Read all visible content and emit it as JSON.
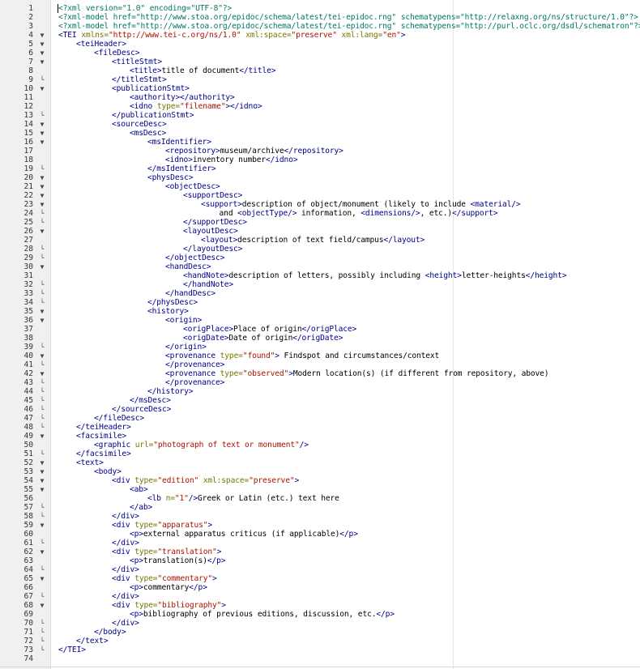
{
  "editor": {
    "colors": {
      "tag": "#000088",
      "attribute": "#777700",
      "value": "#aa1100",
      "processing_instruction": "#007766",
      "text": "#000000",
      "gutter": "#f0f0f0"
    },
    "lines": [
      {
        "n": "1",
        "fold": "",
        "indent": 0,
        "code": [
          [
            "pi",
            "<?xml version=\"1.0\" encoding=\"UTF-8\"?>"
          ]
        ]
      },
      {
        "n": "2",
        "fold": "",
        "indent": 0,
        "code": [
          [
            "pi",
            "<?xml-model href=\"http://www.stoa.org/epidoc/schema/latest/tei-epidoc.rng\" schematypens=\"http://relaxng.org/ns/structure/1.0\"?>"
          ]
        ]
      },
      {
        "n": "3",
        "fold": "",
        "indent": 0,
        "code": [
          [
            "pi",
            "<?xml-model href=\"http://www.stoa.org/epidoc/schema/latest/tei-epidoc.rng\" schematypens=\"http://purl.oclc.org/dsdl/schematron\"?>"
          ]
        ]
      },
      {
        "n": "4",
        "fold": "open",
        "indent": 0,
        "code": [
          [
            "t",
            "<TEI"
          ],
          [
            "x",
            " "
          ],
          [
            "a",
            "xmlns="
          ],
          [
            "v",
            "\"http://www.tei-c.org/ns/1.0\""
          ],
          [
            "x",
            " "
          ],
          [
            "a",
            "xml:space="
          ],
          [
            "v",
            "\"preserve\""
          ],
          [
            "x",
            " "
          ],
          [
            "a",
            "xml:lang="
          ],
          [
            "v",
            "\"en\""
          ],
          [
            "t",
            ">"
          ]
        ]
      },
      {
        "n": "5",
        "fold": "open",
        "indent": 1,
        "code": [
          [
            "t",
            "<teiHeader>"
          ]
        ]
      },
      {
        "n": "6",
        "fold": "open",
        "indent": 2,
        "code": [
          [
            "t",
            "<fileDesc>"
          ]
        ]
      },
      {
        "n": "7",
        "fold": "open",
        "indent": 3,
        "code": [
          [
            "t",
            "<titleStmt>"
          ]
        ]
      },
      {
        "n": "8",
        "fold": "",
        "indent": 4,
        "code": [
          [
            "t",
            "<title>"
          ],
          [
            "x",
            "title of document"
          ],
          [
            "t",
            "</title>"
          ]
        ]
      },
      {
        "n": "9",
        "fold": "close",
        "indent": 3,
        "code": [
          [
            "t",
            "</titleStmt>"
          ]
        ]
      },
      {
        "n": "10",
        "fold": "open",
        "indent": 3,
        "code": [
          [
            "t",
            "<publicationStmt>"
          ]
        ]
      },
      {
        "n": "11",
        "fold": "",
        "indent": 4,
        "code": [
          [
            "t",
            "<authority></authority>"
          ]
        ]
      },
      {
        "n": "12",
        "fold": "",
        "indent": 4,
        "code": [
          [
            "t",
            "<idno"
          ],
          [
            "x",
            " "
          ],
          [
            "a",
            "type="
          ],
          [
            "v",
            "\"filename\""
          ],
          [
            "t",
            "></idno>"
          ]
        ]
      },
      {
        "n": "13",
        "fold": "close",
        "indent": 3,
        "code": [
          [
            "t",
            "</publicationStmt>"
          ]
        ]
      },
      {
        "n": "14",
        "fold": "open",
        "indent": 3,
        "code": [
          [
            "t",
            "<sourceDesc>"
          ]
        ]
      },
      {
        "n": "15",
        "fold": "open",
        "indent": 4,
        "code": [
          [
            "t",
            "<msDesc>"
          ]
        ]
      },
      {
        "n": "16",
        "fold": "open",
        "indent": 5,
        "code": [
          [
            "t",
            "<msIdentifier>"
          ]
        ]
      },
      {
        "n": "17",
        "fold": "",
        "indent": 6,
        "code": [
          [
            "t",
            "<repository>"
          ],
          [
            "x",
            "museum/archive"
          ],
          [
            "t",
            "</repository>"
          ]
        ]
      },
      {
        "n": "18",
        "fold": "",
        "indent": 6,
        "code": [
          [
            "t",
            "<idno>"
          ],
          [
            "x",
            "inventory number"
          ],
          [
            "t",
            "</idno>"
          ]
        ]
      },
      {
        "n": "19",
        "fold": "close",
        "indent": 5,
        "code": [
          [
            "t",
            "</msIdentifier>"
          ]
        ]
      },
      {
        "n": "20",
        "fold": "open",
        "indent": 5,
        "code": [
          [
            "t",
            "<physDesc>"
          ]
        ]
      },
      {
        "n": "21",
        "fold": "open",
        "indent": 6,
        "code": [
          [
            "t",
            "<objectDesc>"
          ]
        ]
      },
      {
        "n": "22",
        "fold": "open",
        "indent": 7,
        "code": [
          [
            "t",
            "<supportDesc>"
          ]
        ]
      },
      {
        "n": "23",
        "fold": "open",
        "indent": 8,
        "code": [
          [
            "t",
            "<support>"
          ],
          [
            "x",
            "description of object/monument (likely to include "
          ],
          [
            "t",
            "<material/>"
          ]
        ]
      },
      {
        "n": "24",
        "fold": "close",
        "indent": 8,
        "code": [
          [
            "x",
            "    and "
          ],
          [
            "t",
            "<objectType/>"
          ],
          [
            "x",
            " information, "
          ],
          [
            "t",
            "<dimensions/>"
          ],
          [
            "x",
            ", etc.)"
          ],
          [
            "t",
            "</support>"
          ]
        ]
      },
      {
        "n": "25",
        "fold": "close",
        "indent": 7,
        "code": [
          [
            "t",
            "</supportDesc>"
          ]
        ]
      },
      {
        "n": "26",
        "fold": "open",
        "indent": 7,
        "code": [
          [
            "t",
            "<layoutDesc>"
          ]
        ]
      },
      {
        "n": "27",
        "fold": "",
        "indent": 8,
        "code": [
          [
            "t",
            "<layout>"
          ],
          [
            "x",
            "description of text field/campus"
          ],
          [
            "t",
            "</layout>"
          ]
        ]
      },
      {
        "n": "28",
        "fold": "close",
        "indent": 7,
        "code": [
          [
            "t",
            "</layoutDesc>"
          ]
        ]
      },
      {
        "n": "29",
        "fold": "close",
        "indent": 6,
        "code": [
          [
            "t",
            "</objectDesc>"
          ]
        ]
      },
      {
        "n": "30",
        "fold": "open",
        "indent": 6,
        "code": [
          [
            "t",
            "<handDesc>"
          ]
        ]
      },
      {
        "n": "31",
        "fold": "",
        "indent": 7,
        "code": [
          [
            "t",
            "<handNote>"
          ],
          [
            "x",
            "description of letters, possibly including "
          ],
          [
            "t",
            "<height>"
          ],
          [
            "x",
            "letter-heights"
          ],
          [
            "t",
            "</height>"
          ]
        ]
      },
      {
        "n": "32",
        "fold": "close",
        "indent": 7,
        "code": [
          [
            "t",
            "</handNote>"
          ]
        ]
      },
      {
        "n": "33",
        "fold": "close",
        "indent": 6,
        "code": [
          [
            "t",
            "</handDesc>"
          ]
        ]
      },
      {
        "n": "34",
        "fold": "close",
        "indent": 5,
        "code": [
          [
            "t",
            "</physDesc>"
          ]
        ]
      },
      {
        "n": "35",
        "fold": "open",
        "indent": 5,
        "code": [
          [
            "t",
            "<history>"
          ]
        ]
      },
      {
        "n": "36",
        "fold": "open",
        "indent": 6,
        "code": [
          [
            "t",
            "<origin>"
          ]
        ]
      },
      {
        "n": "37",
        "fold": "",
        "indent": 7,
        "code": [
          [
            "t",
            "<origPlace>"
          ],
          [
            "x",
            "Place of origin"
          ],
          [
            "t",
            "</origPlace>"
          ]
        ]
      },
      {
        "n": "38",
        "fold": "",
        "indent": 7,
        "code": [
          [
            "t",
            "<origDate>"
          ],
          [
            "x",
            "Date of origin"
          ],
          [
            "t",
            "</origDate>"
          ]
        ]
      },
      {
        "n": "39",
        "fold": "close",
        "indent": 6,
        "code": [
          [
            "t",
            "</origin>"
          ]
        ]
      },
      {
        "n": "40",
        "fold": "open",
        "indent": 6,
        "code": [
          [
            "t",
            "<provenance"
          ],
          [
            "x",
            " "
          ],
          [
            "a",
            "type="
          ],
          [
            "v",
            "\"found\""
          ],
          [
            "t",
            ">"
          ],
          [
            "x",
            " Findspot and circumstances/context"
          ]
        ]
      },
      {
        "n": "41",
        "fold": "close",
        "indent": 6,
        "code": [
          [
            "t",
            "</provenance>"
          ]
        ]
      },
      {
        "n": "42",
        "fold": "open",
        "indent": 6,
        "code": [
          [
            "t",
            "<provenance"
          ],
          [
            "x",
            " "
          ],
          [
            "a",
            "type="
          ],
          [
            "v",
            "\"observed\""
          ],
          [
            "t",
            ">"
          ],
          [
            "x",
            "Modern location(s) (if different from repository, above)"
          ]
        ]
      },
      {
        "n": "43",
        "fold": "close",
        "indent": 6,
        "code": [
          [
            "t",
            "</provenance>"
          ]
        ]
      },
      {
        "n": "44",
        "fold": "close",
        "indent": 5,
        "code": [
          [
            "t",
            "</history>"
          ]
        ]
      },
      {
        "n": "45",
        "fold": "close",
        "indent": 4,
        "code": [
          [
            "t",
            "</msDesc>"
          ]
        ]
      },
      {
        "n": "46",
        "fold": "close",
        "indent": 3,
        "code": [
          [
            "t",
            "</sourceDesc>"
          ]
        ]
      },
      {
        "n": "47",
        "fold": "close",
        "indent": 2,
        "code": [
          [
            "t",
            "</fileDesc>"
          ]
        ]
      },
      {
        "n": "48",
        "fold": "close",
        "indent": 1,
        "code": [
          [
            "t",
            "</teiHeader>"
          ]
        ]
      },
      {
        "n": "49",
        "fold": "open",
        "indent": 1,
        "code": [
          [
            "t",
            "<facsimile>"
          ]
        ]
      },
      {
        "n": "50",
        "fold": "",
        "indent": 2,
        "code": [
          [
            "t",
            "<graphic"
          ],
          [
            "x",
            " "
          ],
          [
            "a",
            "url="
          ],
          [
            "v",
            "\"photograph of text or monument\""
          ],
          [
            "t",
            "/>"
          ]
        ]
      },
      {
        "n": "51",
        "fold": "close",
        "indent": 1,
        "code": [
          [
            "t",
            "</facsimile>"
          ]
        ]
      },
      {
        "n": "52",
        "fold": "open",
        "indent": 1,
        "code": [
          [
            "t",
            "<text>"
          ]
        ]
      },
      {
        "n": "53",
        "fold": "open",
        "indent": 2,
        "code": [
          [
            "t",
            "<body>"
          ]
        ]
      },
      {
        "n": "54",
        "fold": "open",
        "indent": 3,
        "code": [
          [
            "t",
            "<div"
          ],
          [
            "x",
            " "
          ],
          [
            "a",
            "type="
          ],
          [
            "v",
            "\"edition\""
          ],
          [
            "x",
            " "
          ],
          [
            "a",
            "xml:space="
          ],
          [
            "v",
            "\"preserve\""
          ],
          [
            "t",
            ">"
          ]
        ]
      },
      {
        "n": "55",
        "fold": "open",
        "indent": 4,
        "code": [
          [
            "t",
            "<ab>"
          ]
        ]
      },
      {
        "n": "56",
        "fold": "",
        "indent": 5,
        "code": [
          [
            "t",
            "<lb"
          ],
          [
            "x",
            " "
          ],
          [
            "a",
            "n="
          ],
          [
            "v",
            "\"1\""
          ],
          [
            "t",
            "/>"
          ],
          [
            "x",
            "Greek or Latin (etc.) text here"
          ]
        ]
      },
      {
        "n": "57",
        "fold": "close",
        "indent": 4,
        "code": [
          [
            "t",
            "</ab>"
          ]
        ]
      },
      {
        "n": "58",
        "fold": "close",
        "indent": 3,
        "code": [
          [
            "t",
            "</div>"
          ]
        ]
      },
      {
        "n": "59",
        "fold": "open",
        "indent": 3,
        "code": [
          [
            "t",
            "<div"
          ],
          [
            "x",
            " "
          ],
          [
            "a",
            "type="
          ],
          [
            "v",
            "\"apparatus\""
          ],
          [
            "t",
            ">"
          ]
        ]
      },
      {
        "n": "60",
        "fold": "",
        "indent": 4,
        "code": [
          [
            "t",
            "<p>"
          ],
          [
            "x",
            "external apparatus criticus (if applicable)"
          ],
          [
            "t",
            "</p>"
          ]
        ]
      },
      {
        "n": "61",
        "fold": "close",
        "indent": 3,
        "code": [
          [
            "t",
            "</div>"
          ]
        ]
      },
      {
        "n": "62",
        "fold": "open",
        "indent": 3,
        "code": [
          [
            "t",
            "<div"
          ],
          [
            "x",
            " "
          ],
          [
            "a",
            "type="
          ],
          [
            "v",
            "\"translation\""
          ],
          [
            "t",
            ">"
          ]
        ]
      },
      {
        "n": "63",
        "fold": "",
        "indent": 4,
        "code": [
          [
            "t",
            "<p>"
          ],
          [
            "x",
            "translation(s)"
          ],
          [
            "t",
            "</p>"
          ]
        ]
      },
      {
        "n": "64",
        "fold": "close",
        "indent": 3,
        "code": [
          [
            "t",
            "</div>"
          ]
        ]
      },
      {
        "n": "65",
        "fold": "open",
        "indent": 3,
        "code": [
          [
            "t",
            "<div"
          ],
          [
            "x",
            " "
          ],
          [
            "a",
            "type="
          ],
          [
            "v",
            "\"commentary\""
          ],
          [
            "t",
            ">"
          ]
        ]
      },
      {
        "n": "66",
        "fold": "",
        "indent": 4,
        "code": [
          [
            "t",
            "<p>"
          ],
          [
            "x",
            "commentary"
          ],
          [
            "t",
            "</p>"
          ]
        ]
      },
      {
        "n": "67",
        "fold": "close",
        "indent": 3,
        "code": [
          [
            "t",
            "</div>"
          ]
        ]
      },
      {
        "n": "68",
        "fold": "open",
        "indent": 3,
        "code": [
          [
            "t",
            "<div"
          ],
          [
            "x",
            " "
          ],
          [
            "a",
            "type="
          ],
          [
            "v",
            "\"bibliography\""
          ],
          [
            "t",
            ">"
          ]
        ]
      },
      {
        "n": "69",
        "fold": "",
        "indent": 4,
        "code": [
          [
            "t",
            "<p>"
          ],
          [
            "x",
            "bibliography of previous editions, discussion, etc."
          ],
          [
            "t",
            "</p>"
          ]
        ]
      },
      {
        "n": "70",
        "fold": "close",
        "indent": 3,
        "code": [
          [
            "t",
            "</div>"
          ]
        ]
      },
      {
        "n": "71",
        "fold": "close",
        "indent": 2,
        "code": [
          [
            "t",
            "</body>"
          ]
        ]
      },
      {
        "n": "72",
        "fold": "close",
        "indent": 1,
        "code": [
          [
            "t",
            "</text>"
          ]
        ]
      },
      {
        "n": "73",
        "fold": "close",
        "indent": 0,
        "code": [
          [
            "t",
            "</TEI>"
          ]
        ]
      },
      {
        "n": "74",
        "fold": "",
        "indent": 0,
        "code": []
      }
    ]
  }
}
